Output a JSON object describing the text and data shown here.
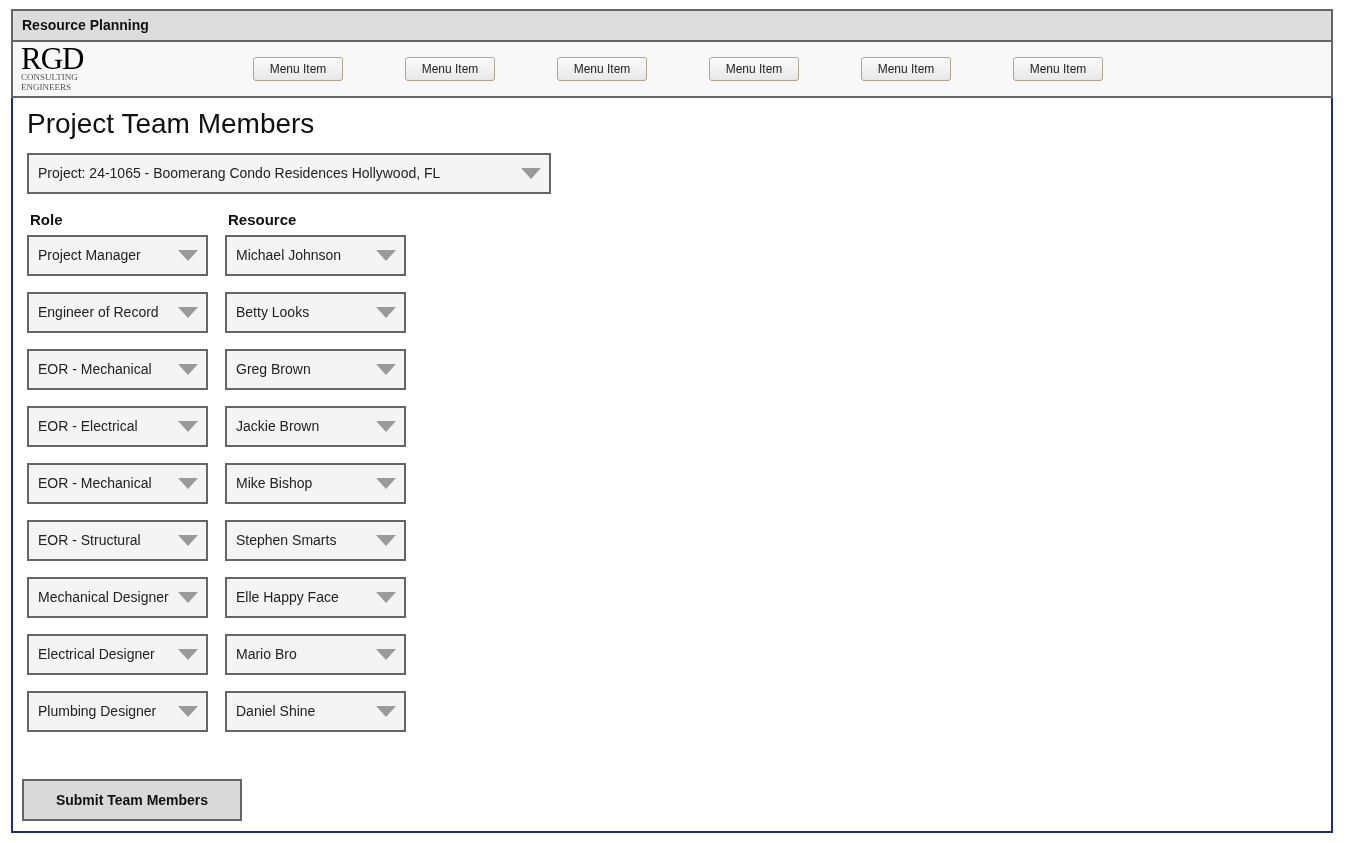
{
  "window": {
    "title": "Resource Planning"
  },
  "logo": {
    "mark": "RGD",
    "line_1": "CONSULTING",
    "line_2": "ENGINEERS"
  },
  "menu": [
    "Menu Item",
    "Menu Item",
    "Menu Item",
    "Menu Item",
    "Menu Item",
    "Menu Item"
  ],
  "page_title": "Project Team Members",
  "project_select": {
    "value": "Project: 24-1065 - Boomerang Condo Residences Hollywood, FL"
  },
  "columns": [
    "Role",
    "Resource"
  ],
  "assignments": [
    {
      "role": "Project Manager",
      "resource": "Michael Johnson"
    },
    {
      "role": "Engineer of Record",
      "resource": "Betty Looks"
    },
    {
      "role": "EOR - Mechanical",
      "resource": "Greg Brown"
    },
    {
      "role": "EOR - Electrical",
      "resource": "Jackie Brown"
    },
    {
      "role": "EOR - Mechanical",
      "resource": "Mike Bishop"
    },
    {
      "role": "EOR - Structural",
      "resource": "Stephen Smarts"
    },
    {
      "role": "Mechanical Designer",
      "resource": "Elle Happy Face"
    },
    {
      "role": "Electrical Designer",
      "resource": "Mario Bro"
    },
    {
      "role": "Plumbing Designer",
      "resource": "Daniel Shine"
    }
  ],
  "submit_button": "Submit Team Members"
}
